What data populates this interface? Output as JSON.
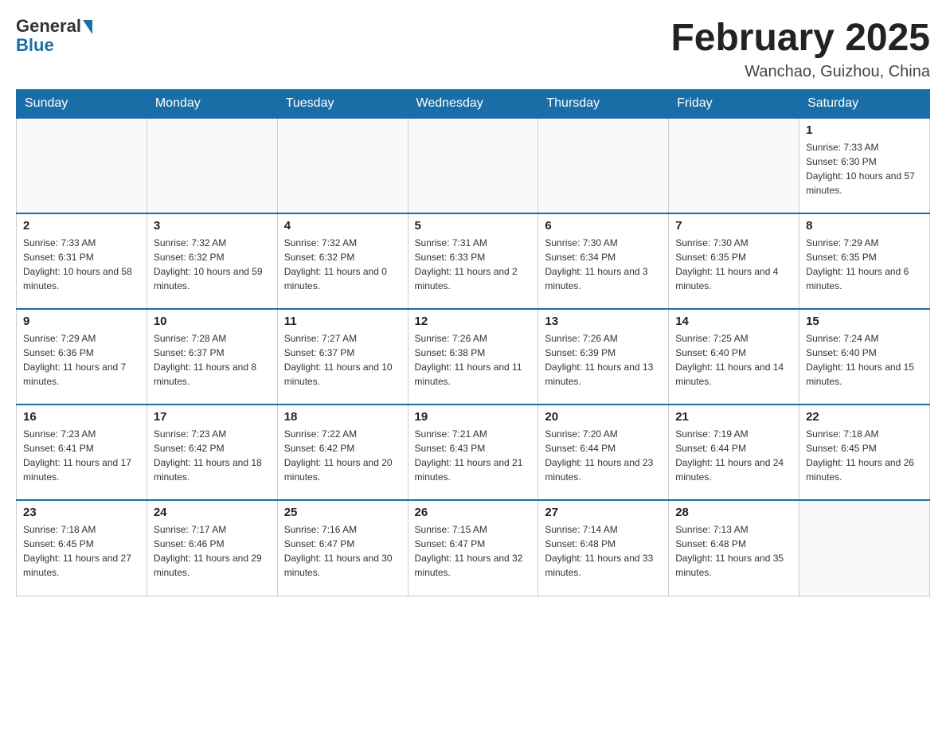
{
  "logo": {
    "general": "General",
    "blue": "Blue"
  },
  "title": {
    "month": "February 2025",
    "location": "Wanchao, Guizhou, China"
  },
  "weekdays": [
    "Sunday",
    "Monday",
    "Tuesday",
    "Wednesday",
    "Thursday",
    "Friday",
    "Saturday"
  ],
  "weeks": [
    [
      {
        "day": "",
        "info": ""
      },
      {
        "day": "",
        "info": ""
      },
      {
        "day": "",
        "info": ""
      },
      {
        "day": "",
        "info": ""
      },
      {
        "day": "",
        "info": ""
      },
      {
        "day": "",
        "info": ""
      },
      {
        "day": "1",
        "info": "Sunrise: 7:33 AM\nSunset: 6:30 PM\nDaylight: 10 hours and 57 minutes."
      }
    ],
    [
      {
        "day": "2",
        "info": "Sunrise: 7:33 AM\nSunset: 6:31 PM\nDaylight: 10 hours and 58 minutes."
      },
      {
        "day": "3",
        "info": "Sunrise: 7:32 AM\nSunset: 6:32 PM\nDaylight: 10 hours and 59 minutes."
      },
      {
        "day": "4",
        "info": "Sunrise: 7:32 AM\nSunset: 6:32 PM\nDaylight: 11 hours and 0 minutes."
      },
      {
        "day": "5",
        "info": "Sunrise: 7:31 AM\nSunset: 6:33 PM\nDaylight: 11 hours and 2 minutes."
      },
      {
        "day": "6",
        "info": "Sunrise: 7:30 AM\nSunset: 6:34 PM\nDaylight: 11 hours and 3 minutes."
      },
      {
        "day": "7",
        "info": "Sunrise: 7:30 AM\nSunset: 6:35 PM\nDaylight: 11 hours and 4 minutes."
      },
      {
        "day": "8",
        "info": "Sunrise: 7:29 AM\nSunset: 6:35 PM\nDaylight: 11 hours and 6 minutes."
      }
    ],
    [
      {
        "day": "9",
        "info": "Sunrise: 7:29 AM\nSunset: 6:36 PM\nDaylight: 11 hours and 7 minutes."
      },
      {
        "day": "10",
        "info": "Sunrise: 7:28 AM\nSunset: 6:37 PM\nDaylight: 11 hours and 8 minutes."
      },
      {
        "day": "11",
        "info": "Sunrise: 7:27 AM\nSunset: 6:37 PM\nDaylight: 11 hours and 10 minutes."
      },
      {
        "day": "12",
        "info": "Sunrise: 7:26 AM\nSunset: 6:38 PM\nDaylight: 11 hours and 11 minutes."
      },
      {
        "day": "13",
        "info": "Sunrise: 7:26 AM\nSunset: 6:39 PM\nDaylight: 11 hours and 13 minutes."
      },
      {
        "day": "14",
        "info": "Sunrise: 7:25 AM\nSunset: 6:40 PM\nDaylight: 11 hours and 14 minutes."
      },
      {
        "day": "15",
        "info": "Sunrise: 7:24 AM\nSunset: 6:40 PM\nDaylight: 11 hours and 15 minutes."
      }
    ],
    [
      {
        "day": "16",
        "info": "Sunrise: 7:23 AM\nSunset: 6:41 PM\nDaylight: 11 hours and 17 minutes."
      },
      {
        "day": "17",
        "info": "Sunrise: 7:23 AM\nSunset: 6:42 PM\nDaylight: 11 hours and 18 minutes."
      },
      {
        "day": "18",
        "info": "Sunrise: 7:22 AM\nSunset: 6:42 PM\nDaylight: 11 hours and 20 minutes."
      },
      {
        "day": "19",
        "info": "Sunrise: 7:21 AM\nSunset: 6:43 PM\nDaylight: 11 hours and 21 minutes."
      },
      {
        "day": "20",
        "info": "Sunrise: 7:20 AM\nSunset: 6:44 PM\nDaylight: 11 hours and 23 minutes."
      },
      {
        "day": "21",
        "info": "Sunrise: 7:19 AM\nSunset: 6:44 PM\nDaylight: 11 hours and 24 minutes."
      },
      {
        "day": "22",
        "info": "Sunrise: 7:18 AM\nSunset: 6:45 PM\nDaylight: 11 hours and 26 minutes."
      }
    ],
    [
      {
        "day": "23",
        "info": "Sunrise: 7:18 AM\nSunset: 6:45 PM\nDaylight: 11 hours and 27 minutes."
      },
      {
        "day": "24",
        "info": "Sunrise: 7:17 AM\nSunset: 6:46 PM\nDaylight: 11 hours and 29 minutes."
      },
      {
        "day": "25",
        "info": "Sunrise: 7:16 AM\nSunset: 6:47 PM\nDaylight: 11 hours and 30 minutes."
      },
      {
        "day": "26",
        "info": "Sunrise: 7:15 AM\nSunset: 6:47 PM\nDaylight: 11 hours and 32 minutes."
      },
      {
        "day": "27",
        "info": "Sunrise: 7:14 AM\nSunset: 6:48 PM\nDaylight: 11 hours and 33 minutes."
      },
      {
        "day": "28",
        "info": "Sunrise: 7:13 AM\nSunset: 6:48 PM\nDaylight: 11 hours and 35 minutes."
      },
      {
        "day": "",
        "info": ""
      }
    ]
  ]
}
